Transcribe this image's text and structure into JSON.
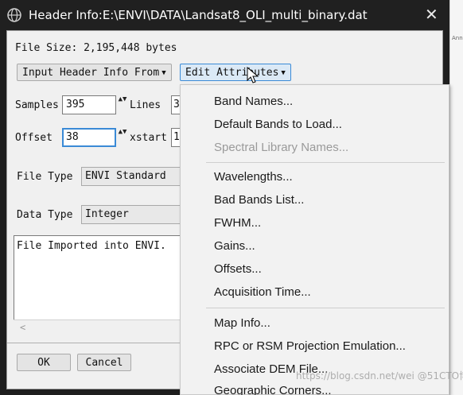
{
  "window": {
    "title": "Header Info:E:\\ENVI\\DATA\\Landsat8_OLI_multi_binary.dat",
    "close_glyph": "✕",
    "app_icon": "envi-globe-icon"
  },
  "background": {
    "partial_text": "Ann"
  },
  "file_size": "File Size: 2,195,448 bytes",
  "toolbar": {
    "input_header_label": "Input Header Info From",
    "edit_attributes_label": "Edit Attributes",
    "dropdown_glyph": "▼"
  },
  "fields": {
    "samples_label": "Samples",
    "samples_value": "395",
    "lines_label": "Lines",
    "lines_value": "3",
    "offset_label": "Offset",
    "offset_value": "38",
    "xstart_label": "xstart",
    "xstart_value": "1",
    "spin_glyph": "▲▼"
  },
  "file_type": {
    "label": "File Type",
    "value": "ENVI Standard"
  },
  "data_type": {
    "label": "Data Type",
    "value": "Integer"
  },
  "description": "File Imported into ENVI.",
  "scroll_left_glyph": "<",
  "buttons": {
    "ok": "OK",
    "cancel": "Cancel"
  },
  "menu": {
    "groups": [
      [
        {
          "label": "Band Names...",
          "enabled": true
        },
        {
          "label": "Default Bands to Load...",
          "enabled": true
        },
        {
          "label": "Spectral Library Names...",
          "enabled": false
        }
      ],
      [
        {
          "label": "Wavelengths...",
          "enabled": true
        },
        {
          "label": "Bad Bands List...",
          "enabled": true
        },
        {
          "label": "FWHM...",
          "enabled": true
        },
        {
          "label": "Gains...",
          "enabled": true
        },
        {
          "label": "Offsets...",
          "enabled": true
        },
        {
          "label": "Acquisition Time...",
          "enabled": true
        }
      ],
      [
        {
          "label": "Map Info...",
          "enabled": true
        },
        {
          "label": "RPC or RSM Projection Emulation...",
          "enabled": true
        },
        {
          "label": "Associate DEM File...",
          "enabled": true
        },
        {
          "label": "Geographic Corners...",
          "enabled": true
        }
      ]
    ]
  },
  "watermark": "https://blog.csdn.net/wei @51CTO博客",
  "colors": {
    "titlebar": "#202020",
    "accent": "#3a8ad6",
    "disabled": "#9a9a9a"
  }
}
